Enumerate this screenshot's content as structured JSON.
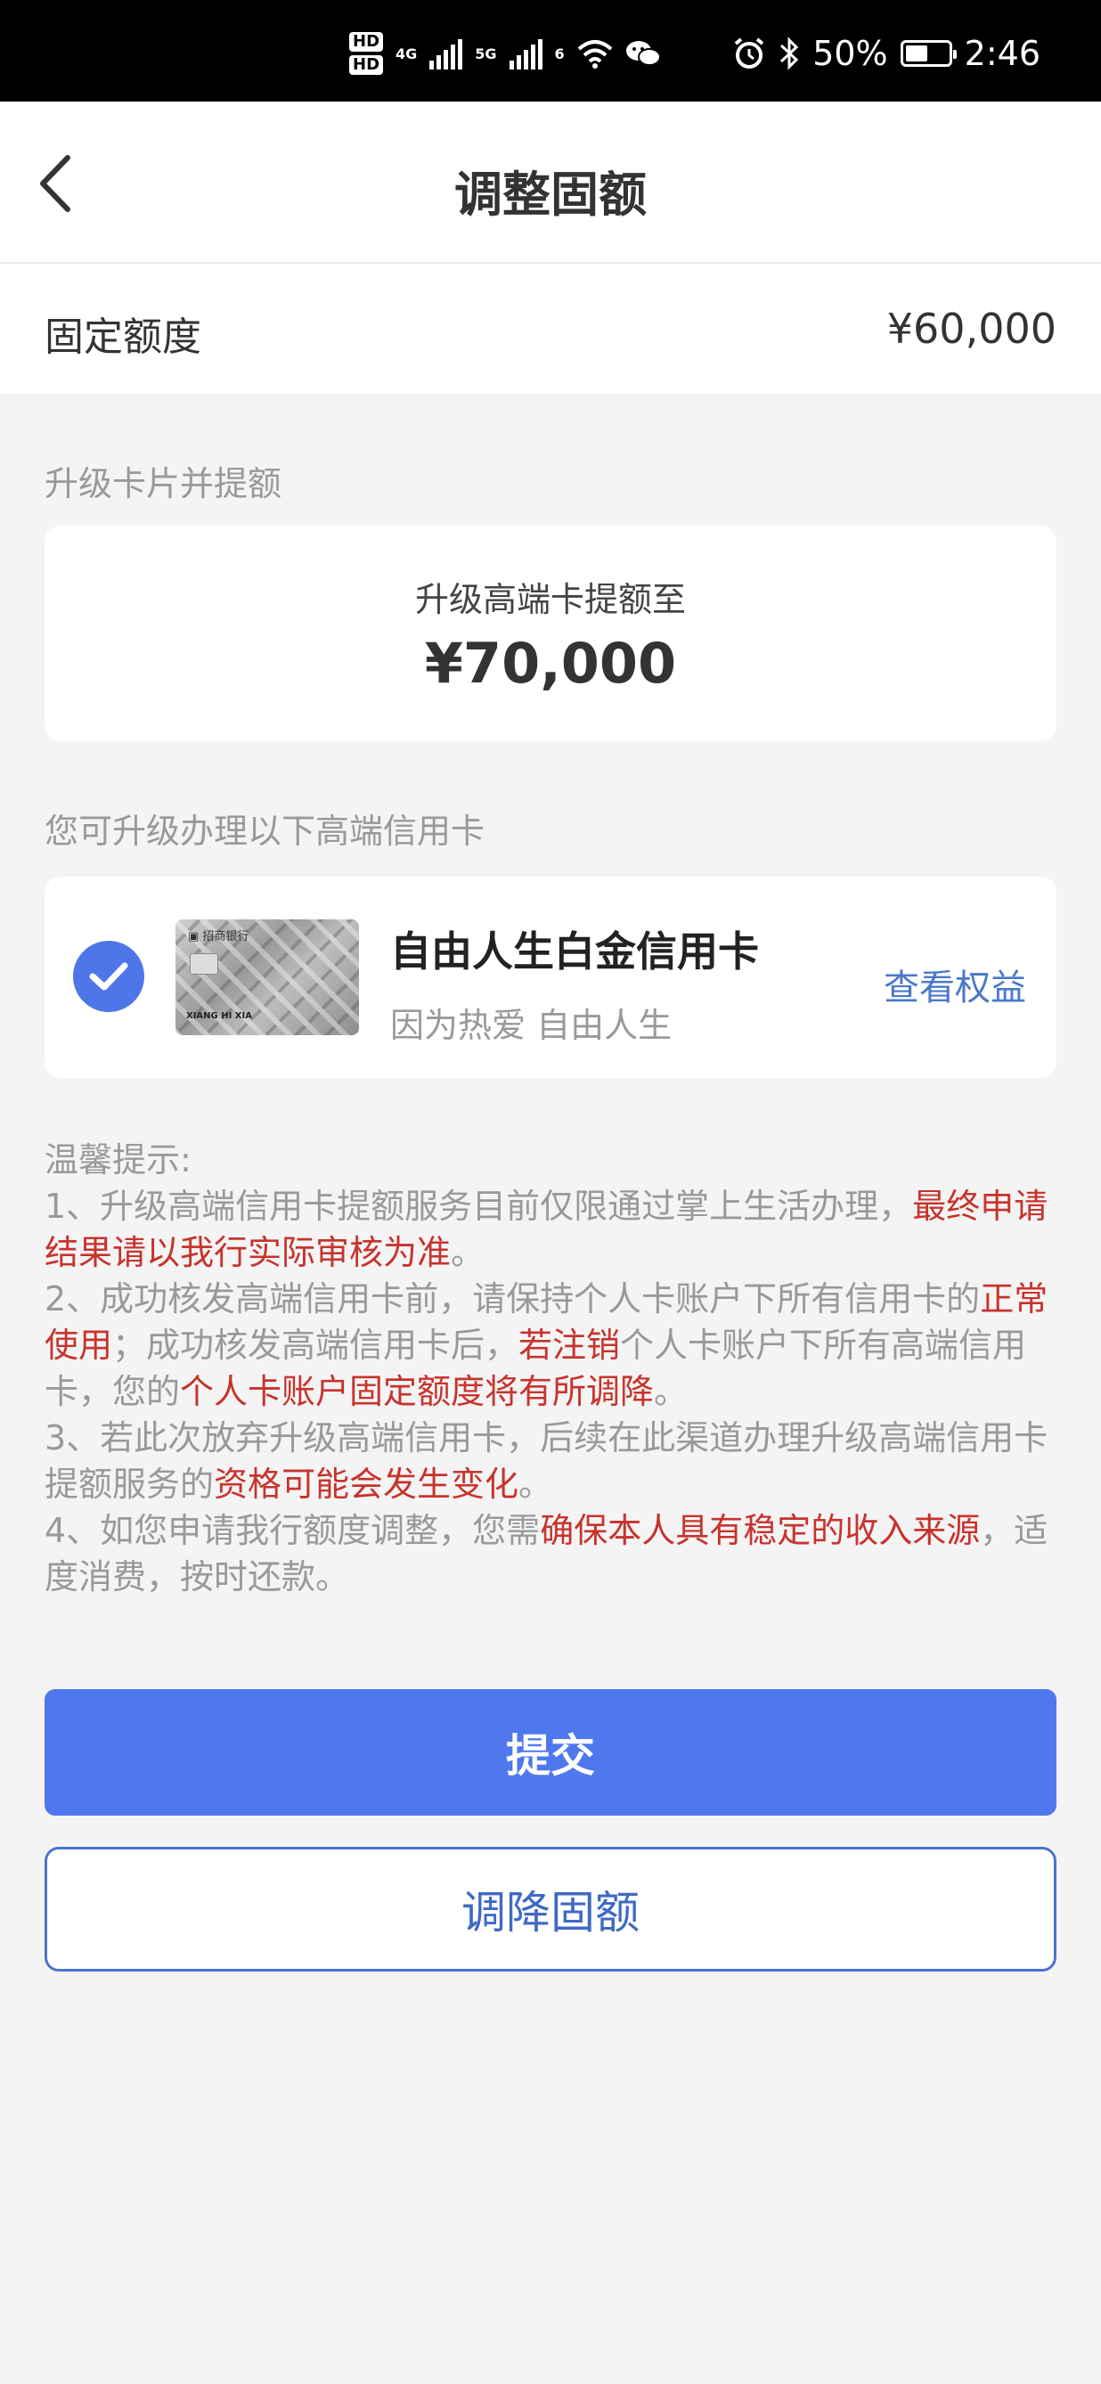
{
  "status_bar": {
    "hd1": "HD",
    "hd2": "HD",
    "net1": "4G",
    "net2": "5G",
    "wifi_num": "6",
    "battery": "50%",
    "time": "2:46"
  },
  "header": {
    "title": "调整固额"
  },
  "fixed_limit": {
    "label": "固定额度",
    "value": "¥60,000"
  },
  "upgrade": {
    "section_label": "升级卡片并提额",
    "subtitle": "升级高端卡提额至",
    "amount": "¥70,000"
  },
  "cards": {
    "section_label": "您可升级办理以下高端信用卡",
    "item": {
      "name": "自由人生白金信用卡",
      "slogan": "因为热爱 自由人生",
      "benefits_link": "查看权益",
      "selected": true
    }
  },
  "tips": {
    "title": "温馨提示:",
    "t1_a": "1、升级高端信用卡提额服务目前仅限通过掌上生活办理，",
    "t1_b": "最终申请结果请以我行实际审核为准",
    "t1_c": "。",
    "t2_a": "2、成功核发高端信用卡前，请保持个人卡账户下所有信用卡的",
    "t2_b": "正常使用",
    "t2_c": "；成功核发高端信用卡后，",
    "t2_d": "若注销",
    "t2_e": "个人卡账户下所有高端信用卡，您的",
    "t2_f": "个人卡账户固定额度将有所调降",
    "t2_g": "。",
    "t3_a": "3、若此次放弃升级高端信用卡，后续在此渠道办理升级高端信用卡提额服务的",
    "t3_b": "资格可能会发生变化",
    "t3_c": "。",
    "t4_a": "4、如您申请我行额度调整，您需",
    "t4_b": "确保本人具有稳定的收入来源",
    "t4_c": "，适度消费，按时还款。"
  },
  "buttons": {
    "submit": "提交",
    "reduce": "调降固额"
  },
  "colors": {
    "primary": "#4f78ee",
    "link": "#4a78c8",
    "warning": "#c8332d"
  }
}
